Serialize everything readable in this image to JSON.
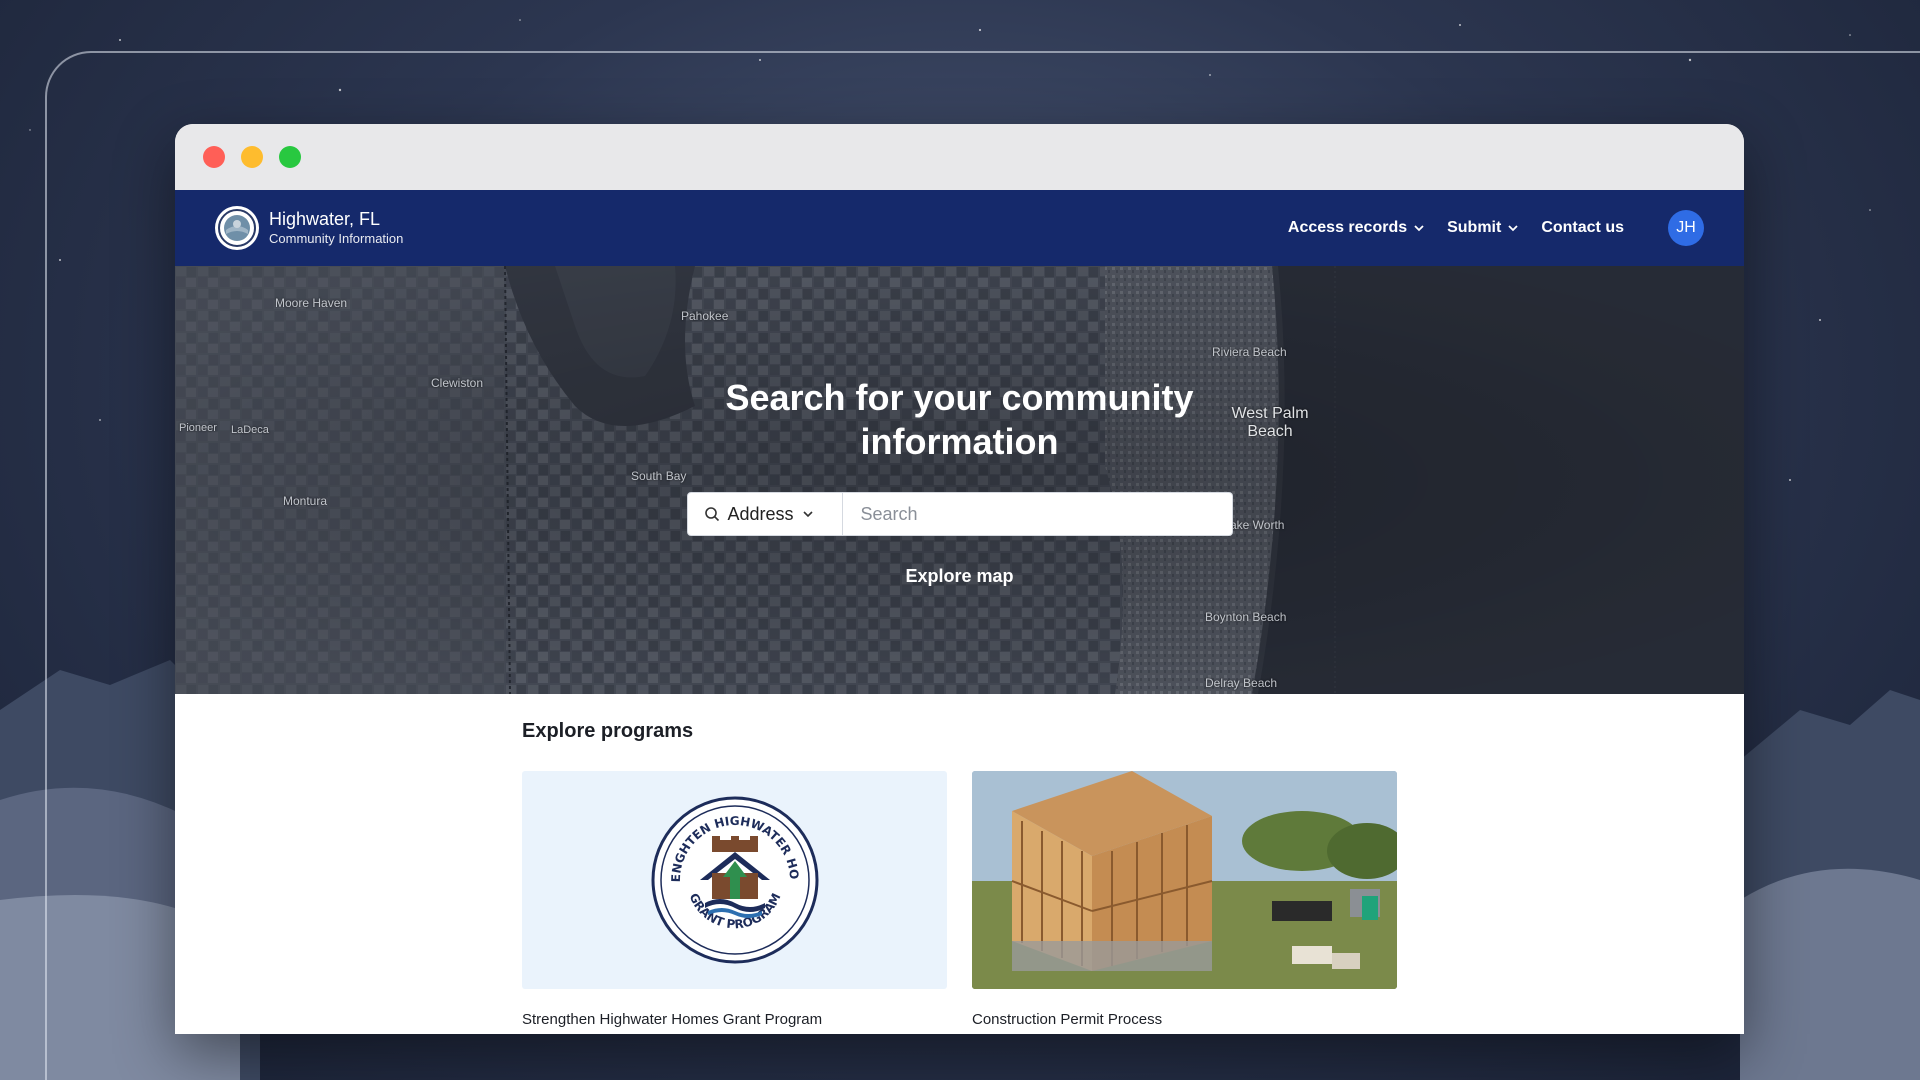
{
  "site": {
    "name": "Highwater, FL",
    "subtitle": "Community Information"
  },
  "nav": {
    "access_records": "Access records",
    "submit": "Submit",
    "contact_us": "Contact us",
    "avatar_initials": "JH"
  },
  "hero": {
    "title": "Search for your community information",
    "search_type": "Address",
    "search_placeholder": "Search",
    "explore_map": "Explore map",
    "map_labels": {
      "moore_haven": "Moore Haven",
      "pahokee": "Pahokee",
      "clewiston": "Clewiston",
      "pioneer": "Pioneer",
      "labelle": "LaDeca",
      "south_bay": "South Bay",
      "montura": "Montura",
      "riviera_beach": "Riviera Beach",
      "west_palm_beach": "West Palm Beach",
      "lake_worth": "ake Worth",
      "boynton_beach": "Boynton Beach",
      "delray_beach": "Delray Beach"
    }
  },
  "programs": {
    "title": "Explore programs",
    "items": [
      {
        "label": "Strengthen Highwater Homes Grant Program",
        "logo_text_top": "STRENGHTEN HIGHWATER HOMES",
        "logo_text_bottom": "GRANT PROGRAM"
      },
      {
        "label": "Construction Permit Process"
      }
    ]
  },
  "colors": {
    "navbar": "#15296b",
    "avatar": "#2f6ce5",
    "hero_bg": "#2b303c",
    "traffic_red": "#ff5f57",
    "traffic_yellow": "#febc2e",
    "traffic_green": "#28c840"
  },
  "icons": {
    "search": "search-icon",
    "chevron": "chevron-down-icon",
    "seal": "city-seal-icon"
  }
}
